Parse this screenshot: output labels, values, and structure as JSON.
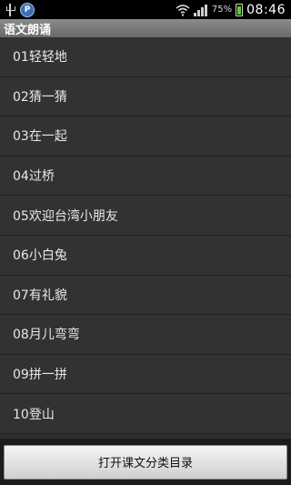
{
  "status_bar": {
    "battery_percent": "75%",
    "time": "08:46",
    "icons": [
      "usb-icon",
      "app-icon",
      "wifi-icon",
      "signal-icon",
      "battery-icon"
    ],
    "app_icon_letter": "P",
    "battery_color": "#5ccf2a"
  },
  "title_bar": {
    "title": "语文朗诵"
  },
  "lessons": [
    {
      "label": "01轻轻地"
    },
    {
      "label": "02猜一猜"
    },
    {
      "label": "03在一起"
    },
    {
      "label": "04过桥"
    },
    {
      "label": "05欢迎台湾小朋友"
    },
    {
      "label": "06小白兔"
    },
    {
      "label": "07有礼貌"
    },
    {
      "label": "08月儿弯弯"
    },
    {
      "label": "09拼一拼"
    },
    {
      "label": "10登山"
    }
  ],
  "bottom_button": {
    "label": "打开课文分类目录"
  }
}
